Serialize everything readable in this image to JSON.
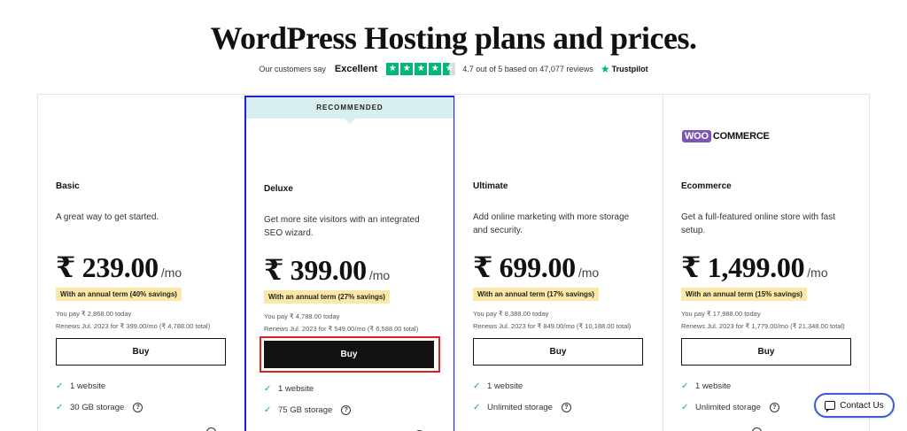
{
  "header": {
    "title": "WordPress Hosting plans and prices.",
    "trust_prefix": "Our customers say",
    "trust_rating": "Excellent",
    "trust_score": "4.7 out of 5 based on 47,077 reviews",
    "trust_brand": "Trustpilot",
    "trust_stars": 4.5
  },
  "colors": {
    "trust_green": "#00b67a",
    "ribbon_bg": "#d8efef",
    "savings_bg": "#fbe8a6",
    "highlight_outline": "#1f1fd6",
    "buy_outline": "#e01e1e",
    "check_color": "#1a9f8c",
    "woo_purple": "#7f54b3"
  },
  "plans": [
    {
      "name": "Basic",
      "description": "A great way to get started.",
      "price": "₹ 239.00",
      "per": "/mo",
      "savings": "With an annual term (40% savings)",
      "pay": "You pay ₹ 2,868.00 today",
      "renew": "Renews Jul. 2023 for ₹ 399.00/mo (₹ 4,788.00 total)",
      "buy_label": "Buy",
      "features": [
        "1 website",
        "30 GB storage"
      ]
    },
    {
      "name": "Deluxe",
      "ribbon": "RECOMMENDED",
      "description": "Get more site visitors with an integrated SEO wizard.",
      "price": "₹ 399.00",
      "per": "/mo",
      "savings": "With an annual term (27% savings)",
      "pay": "You pay ₹ 4,788.00 today",
      "renew": "Renews Jul. 2023 for ₹ 549.00/mo (₹ 6,588.00 total)",
      "buy_label": "Buy",
      "features": [
        "1 website",
        "75 GB storage"
      ]
    },
    {
      "name": "Ultimate",
      "description": "Add online marketing with more storage and security.",
      "price": "₹ 699.00",
      "per": "/mo",
      "savings": "With an annual term (17% savings)",
      "pay": "You pay ₹ 8,388.00 today",
      "renew": "Renews Jul. 2023 for ₹ 849.00/mo (₹ 10,188.00 total)",
      "buy_label": "Buy",
      "features": [
        "1 website",
        "Unlimited storage"
      ]
    },
    {
      "name": "Ecommerce",
      "logo_woo": "WOO",
      "logo_commerce": "COMMERCE",
      "description": "Get a full-featured online store with fast setup.",
      "price": "₹ 1,499.00",
      "per": "/mo",
      "savings": "With an annual term (15% savings)",
      "pay": "You pay ₹ 17,988.00 today",
      "renew": "Renews Jul. 2023 for ₹ 1,779.00/mo (₹ 21,348.00 total)",
      "buy_label": "Buy",
      "features": [
        "1 website",
        "Unlimited storage"
      ]
    }
  ],
  "help_glyph": "?",
  "check_glyph": "✓",
  "star_glyph": "★",
  "contact": {
    "label": "Contact Us"
  }
}
